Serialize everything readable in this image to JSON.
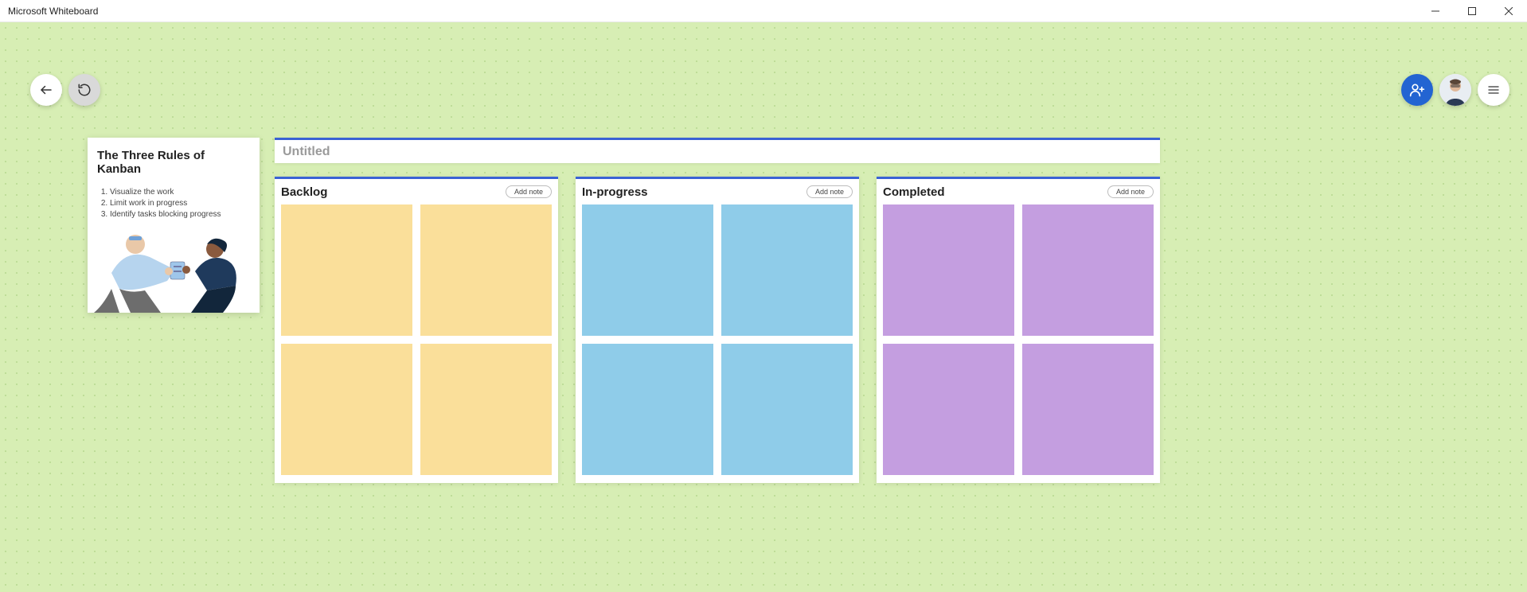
{
  "app_title": "Microsoft Whiteboard",
  "board_title": "Untitled",
  "info_card": {
    "heading": "The Three Rules of Kanban",
    "rules": [
      "Visualize the work",
      "Limit work in progress",
      "Identify tasks blocking progress"
    ]
  },
  "columns": [
    {
      "title": "Backlog",
      "add_label": "Add note",
      "note_color": "yellow"
    },
    {
      "title": "In-progress",
      "add_label": "Add note",
      "note_color": "blue"
    },
    {
      "title": "Completed",
      "add_label": "Add note",
      "note_color": "purple"
    }
  ],
  "colors": {
    "canvas_bg": "#d7eeb4",
    "accent_blue": "#2364d2",
    "strip_border": "#3a63d4",
    "note_yellow": "#fadf9a",
    "note_blue": "#8fcce9",
    "note_purple": "#c49ee0"
  },
  "icons": {
    "back": "back-arrow-icon",
    "undo": "undo-icon",
    "invite": "person-add-icon",
    "avatar": "user-avatar",
    "menu": "hamburger-icon",
    "minimize": "minimize-icon",
    "maximize": "maximize-icon",
    "close": "close-icon"
  }
}
